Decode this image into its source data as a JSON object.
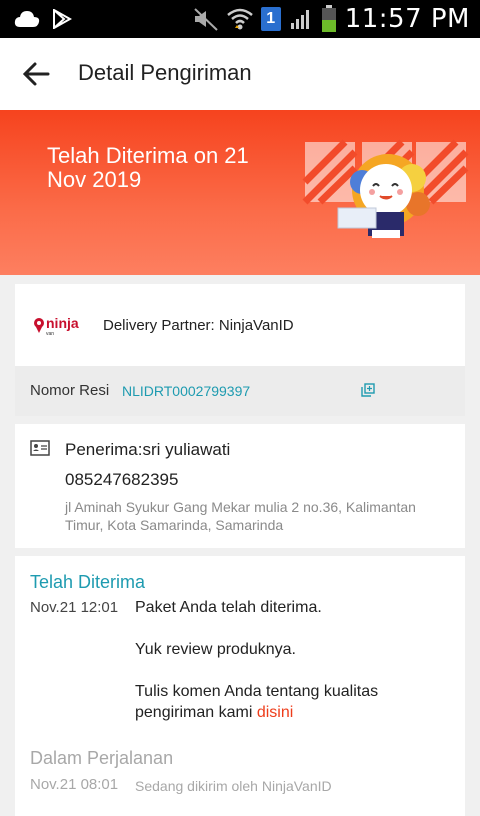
{
  "statusbar": {
    "sim_number": "1",
    "time": "11:57 PM"
  },
  "appbar": {
    "title": "Detail Pengiriman"
  },
  "banner": {
    "title": "Telah Diterima on 21 Nov 2019"
  },
  "partner": {
    "logo_text": "ninja",
    "logo_subtext": "van",
    "label": "Delivery Partner: NinjaVanID"
  },
  "resi": {
    "label": "Nomor Resi",
    "value": "NLIDRT0002799397"
  },
  "recipient": {
    "name": "Penerima:sri yuliawati",
    "phone": "085247682395",
    "address": "jl Aminah Syukur Gang Mekar mulia 2 no.36, Kalimantan Timur, Kota Samarinda, Samarinda"
  },
  "tracking": {
    "current_status": "Telah Diterima",
    "current_time": "Nov.21 12:01",
    "current_line1": "Paket Anda telah diterima.",
    "current_line2": "Yuk review produknya.",
    "current_line3": "Tulis komen Anda tentang kualitas pengiriman kami",
    "current_link": "disini",
    "previous_status": "Dalam Perjalanan",
    "previous_time": "Nov.21 08:01",
    "previous_text": "Sedang dikirim oleh NinjaVanID"
  },
  "colors": {
    "banner": "#f6431e",
    "accent_teal": "#1e9bb0",
    "link_red": "#ee3d1b"
  },
  "icons": [
    "cloud-icon",
    "play-store-icon",
    "mute-icon",
    "wifi-icon",
    "signal-icon",
    "battery-icon",
    "back-arrow-icon",
    "copy-icon",
    "id-card-icon"
  ]
}
